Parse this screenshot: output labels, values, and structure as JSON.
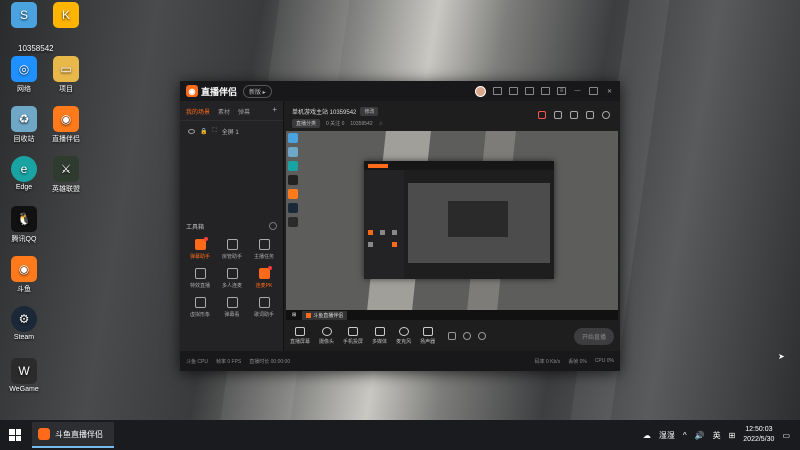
{
  "desktop": {
    "id_label": "10358542",
    "icons": [
      {
        "label": "网络",
        "icon": "network-icon"
      },
      {
        "label": "回收站",
        "icon": "recycle-bin-icon"
      },
      {
        "label": "Edge",
        "icon": "edge-icon"
      },
      {
        "label": "腾讯QQ",
        "icon": "qq-icon"
      },
      {
        "label": "斗鱼",
        "icon": "douyu-icon"
      },
      {
        "label": "Steam",
        "icon": "steam-icon"
      },
      {
        "label": "WeGame",
        "icon": "wegame-icon"
      },
      {
        "label": "项目",
        "icon": "folder-icon"
      },
      {
        "label": "直播伴侣",
        "icon": "douyu-companion-icon"
      },
      {
        "label": "英雄联盟",
        "icon": "game-icon"
      }
    ]
  },
  "app": {
    "title": "直播伴侣",
    "version_badge": "新版 ▸",
    "left_tabs": [
      "我的场景",
      "素材",
      "弹幕",
      "+"
    ],
    "active_tab": "我的场景",
    "scene_name": "全屏 1",
    "tools_title": "工具箱",
    "tools": [
      {
        "label": "弹幕助手",
        "accent": true,
        "dot": true
      },
      {
        "label": "房管助手",
        "accent": false,
        "dot": false
      },
      {
        "label": "主播任务",
        "accent": false,
        "dot": false
      },
      {
        "label": "特效直播",
        "accent": false,
        "dot": false
      },
      {
        "label": "多人连麦",
        "accent": false,
        "dot": false
      },
      {
        "label": "连麦PK",
        "accent": true,
        "dot": true
      },
      {
        "label": "虚拟形象",
        "accent": false,
        "dot": false
      },
      {
        "label": "弹幕看",
        "accent": false,
        "dot": false
      },
      {
        "label": "歌词助手",
        "accent": false,
        "dot": false
      }
    ],
    "room": {
      "title": "单机游戏主站 10359542",
      "edit_btn": "修改",
      "category_btn": "直播分类",
      "fans": "0 关注 0",
      "room_id": "10359542"
    },
    "toolbar": [
      {
        "label": "直播屏幕",
        "icon": "screen-icon"
      },
      {
        "label": "摄像头",
        "icon": "camera-icon"
      },
      {
        "label": "手机投屏",
        "icon": "phone-icon"
      },
      {
        "label": "多媒体",
        "icon": "media-icon"
      },
      {
        "label": "麦克风",
        "icon": "mic-icon"
      },
      {
        "label": "扬声器",
        "icon": "speaker-icon"
      }
    ],
    "start_live": "开始直播",
    "status_left": [
      "斗鱼 CPU",
      "帧率 0 FPS",
      "直播时长 00:00:00"
    ],
    "status_right": [
      "码率 0 Kb/s",
      "丢帧 0%",
      "CPU 0%"
    ],
    "preview_taskbar_app": "斗鱼直播伴侣"
  },
  "taskbar": {
    "app_label": "斗鱼直播伴侣",
    "weather": "湿湿",
    "ime": "英",
    "time": "12:50:03",
    "date": "2022/5/30"
  }
}
